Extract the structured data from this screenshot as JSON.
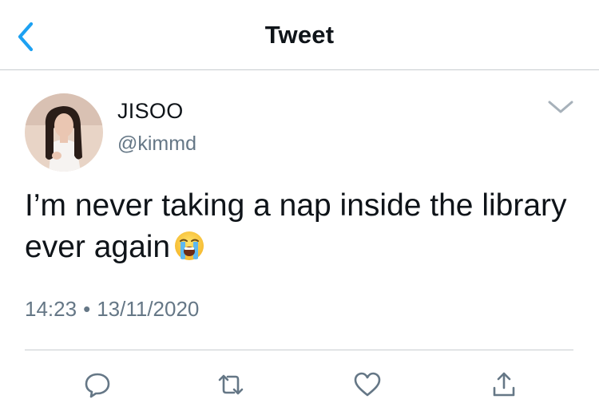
{
  "nav": {
    "title": "Tweet",
    "back_icon": "chevron-left-icon",
    "accent_color": "#1da1f2"
  },
  "tweet": {
    "display_name": "JISOO",
    "handle": "@kimmd",
    "text": "I’m never taking a nap inside the library ever again",
    "emoji": "loudly-crying-face",
    "time": "14:23",
    "separator": "•",
    "date": "13/11/2020"
  },
  "actions": [
    {
      "icon": "reply-icon"
    },
    {
      "icon": "retweet-icon"
    },
    {
      "icon": "like-icon"
    },
    {
      "icon": "share-icon"
    }
  ],
  "colors": {
    "text": "#0f1419",
    "secondary": "#657786",
    "divider": "#c8ccd0",
    "icon": "#657786"
  }
}
